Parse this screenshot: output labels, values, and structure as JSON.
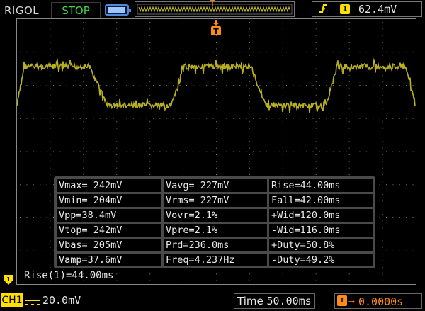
{
  "header": {
    "brand": "RIGOL",
    "run_status": "STOP",
    "trigger_channel": "1",
    "trigger_level": "62.4mV"
  },
  "measurements": [
    [
      "Vmax= 242mV",
      "Vavg= 227mV",
      "Rise=44.00ms"
    ],
    [
      "Vmin= 204mV",
      "Vrms= 227mV",
      "Fall=42.00ms"
    ],
    [
      "Vpp=38.4mV",
      "Vovr=2.1%",
      "+Wid=120.0ms"
    ],
    [
      "Vtop= 242mV",
      "Vpre=2.1%",
      "-Wid=116.0ms"
    ],
    [
      "Vbas= 205mV",
      "Prd=236.0ms",
      "+Duty=50.8%"
    ],
    [
      "Vamp=37.6mV",
      "Freq=4.237Hz",
      "-Duty=49.2%"
    ]
  ],
  "cursor_readout": "Rise(1)=44.00ms",
  "footer": {
    "channel": "CH1",
    "vertical_scale": "20.0mV",
    "time_label": "Time",
    "timebase": "50.00ms",
    "trigger_offset": "0.0000s"
  },
  "colors": {
    "trace": "#b8b020",
    "channel": "#ffe000",
    "trigger": "#ff8c1a",
    "run_status": "#3fd84a"
  },
  "icons": {
    "trigger_edge": "rising-edge-icon",
    "battery": "battery-icon",
    "trigger_position": "trigger-position-icon",
    "coupling": "dc-coupling-icon"
  }
}
